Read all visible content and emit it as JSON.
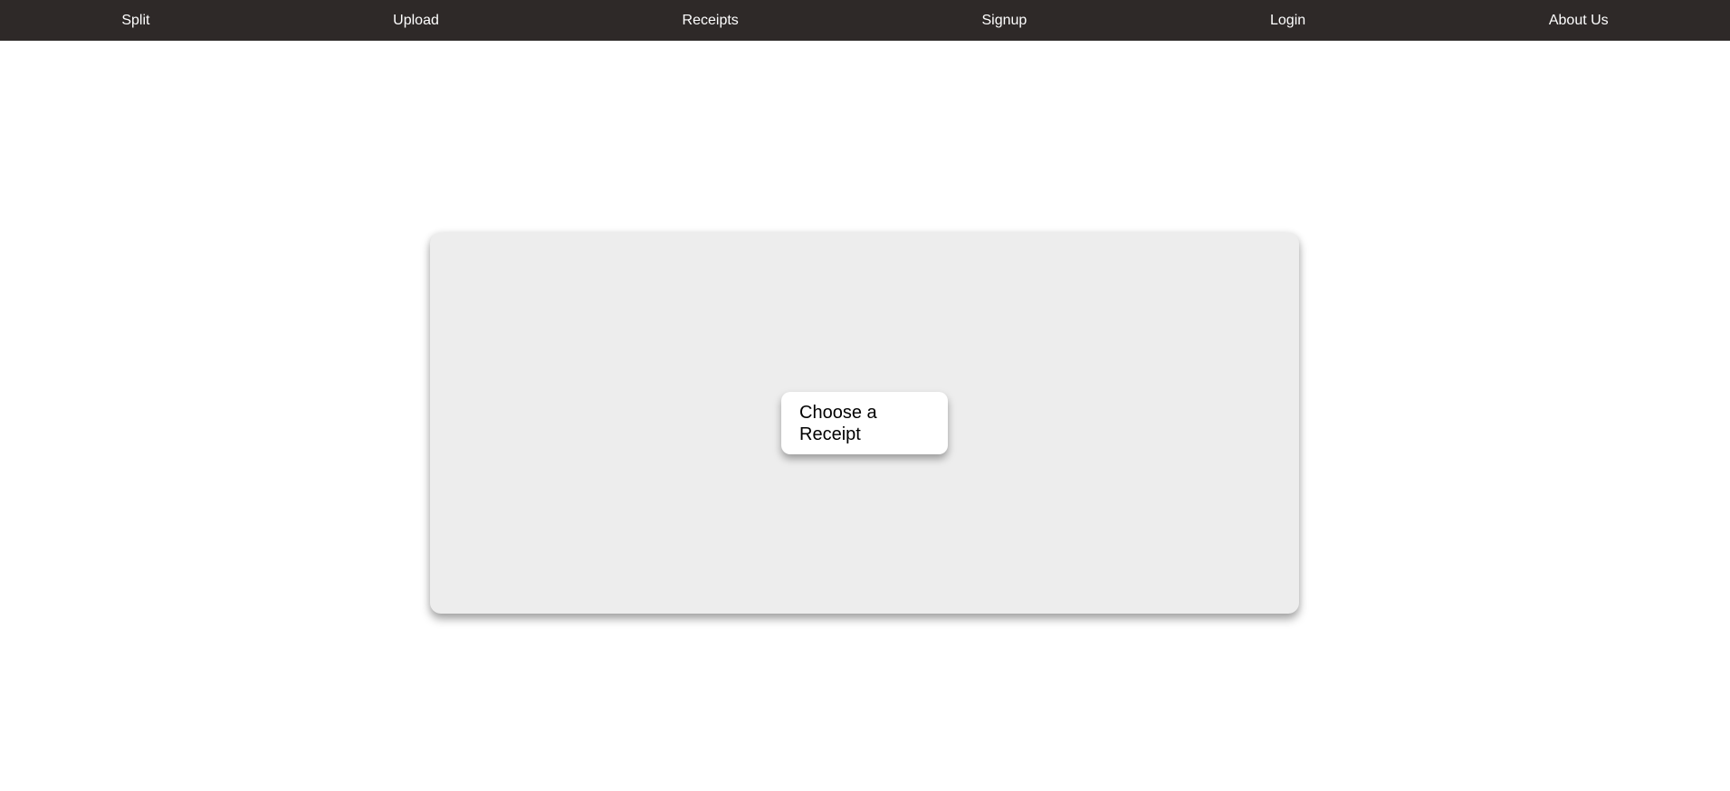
{
  "navbar": {
    "background": "#2e2928",
    "items": [
      {
        "label": "Split"
      },
      {
        "label": "Upload"
      },
      {
        "label": "Receipts"
      },
      {
        "label": "Signup"
      },
      {
        "label": "Login"
      },
      {
        "label": "About Us"
      }
    ]
  },
  "upload_panel": {
    "background": "#ededed",
    "choose_button_label": "Choose a Receipt"
  }
}
